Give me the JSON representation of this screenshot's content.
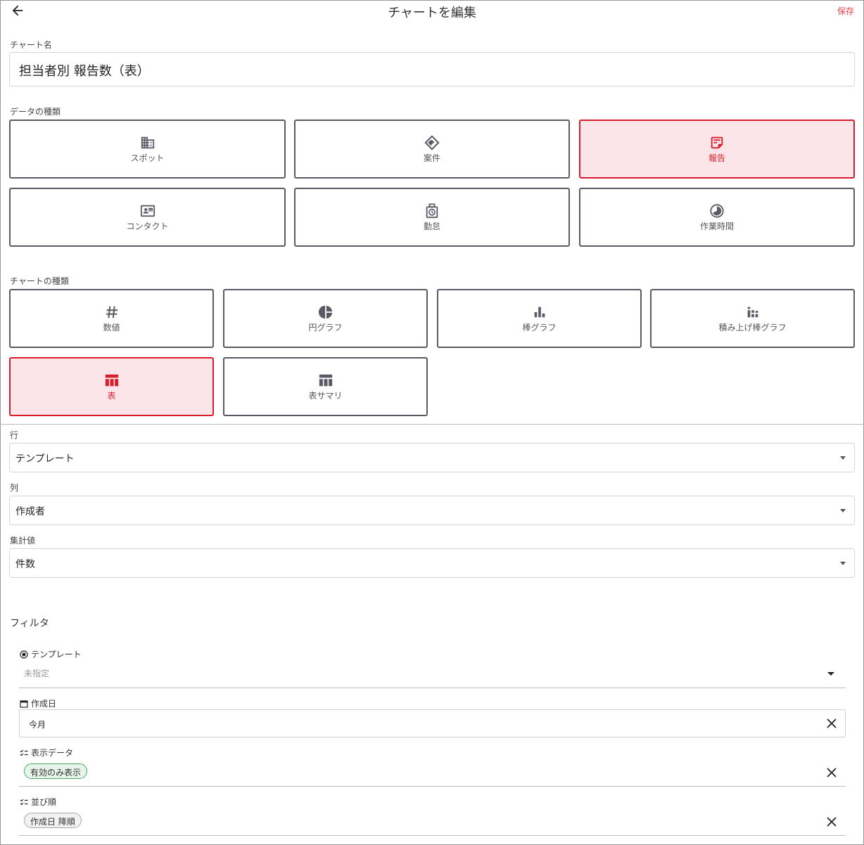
{
  "header": {
    "title": "チャートを編集",
    "save_label": "保存"
  },
  "chart_name": {
    "label": "チャート名",
    "value": "担当者別 報告数（表）"
  },
  "data_type": {
    "label": "データの種類",
    "options": [
      {
        "label": "スポット",
        "icon": "building-icon",
        "selected": false
      },
      {
        "label": "案件",
        "icon": "handshake-icon",
        "selected": false
      },
      {
        "label": "報告",
        "icon": "report-note-icon",
        "selected": true
      },
      {
        "label": "コンタクト",
        "icon": "contact-card-icon",
        "selected": false
      },
      {
        "label": "勤怠",
        "icon": "timeclock-icon",
        "selected": false
      },
      {
        "label": "作業時間",
        "icon": "clock-pie-icon",
        "selected": false
      }
    ]
  },
  "chart_type": {
    "label": "チャートの種類",
    "options": [
      {
        "label": "数値",
        "icon": "hash-icon",
        "selected": false
      },
      {
        "label": "円グラフ",
        "icon": "pie-chart-icon",
        "selected": false
      },
      {
        "label": "棒グラフ",
        "icon": "bar-chart-icon",
        "selected": false
      },
      {
        "label": "積み上げ棒グラフ",
        "icon": "stacked-bar-icon",
        "selected": false
      },
      {
        "label": "表",
        "icon": "table-icon",
        "selected": true
      },
      {
        "label": "表サマリ",
        "icon": "table-summary-icon",
        "selected": false
      }
    ]
  },
  "row": {
    "label": "行",
    "value": "テンプレート"
  },
  "column": {
    "label": "列",
    "value": "作成者"
  },
  "aggregate": {
    "label": "集計値",
    "value": "件数"
  },
  "filter": {
    "heading": "フィルタ",
    "template": {
      "label": "テンプレート",
      "placeholder": "未指定"
    },
    "created": {
      "label": "作成日",
      "value": "今月"
    },
    "display": {
      "label": "表示データ",
      "chip": "有効のみ表示"
    },
    "sort": {
      "label": "並び順",
      "chip": "作成日 降順"
    }
  },
  "colors": {
    "accent": "#d81e2c",
    "accent_bg": "#fbe5e8",
    "chip_green": "#49a766"
  }
}
